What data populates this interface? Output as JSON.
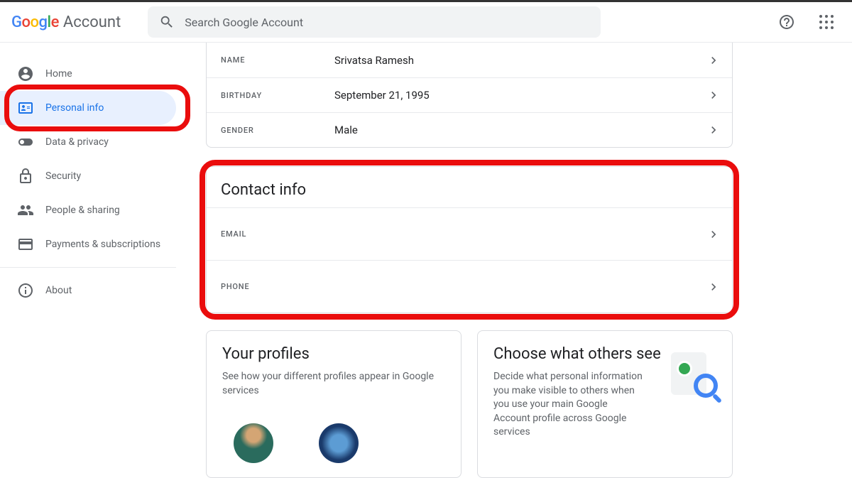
{
  "header": {
    "account_label": "Account",
    "search_placeholder": "Search Google Account"
  },
  "sidebar": {
    "items": [
      {
        "label": "Home"
      },
      {
        "label": "Personal info"
      },
      {
        "label": "Data & privacy"
      },
      {
        "label": "Security"
      },
      {
        "label": "People & sharing"
      },
      {
        "label": "Payments & subscriptions"
      },
      {
        "label": "About"
      }
    ]
  },
  "basic_info": {
    "rows": [
      {
        "label": "NAME",
        "value": "Srivatsa Ramesh"
      },
      {
        "label": "BIRTHDAY",
        "value": "September 21, 1995"
      },
      {
        "label": "GENDER",
        "value": "Male"
      }
    ]
  },
  "contact_info": {
    "heading": "Contact info",
    "rows": [
      {
        "label": "EMAIL"
      },
      {
        "label": "PHONE"
      }
    ]
  },
  "profiles": {
    "heading": "Your profiles",
    "text": "See how your different profiles appear in Google services"
  },
  "others_see": {
    "heading": "Choose what others see",
    "text": "Decide what personal information you make visible to others when you use your main Google Account profile across Google services"
  }
}
